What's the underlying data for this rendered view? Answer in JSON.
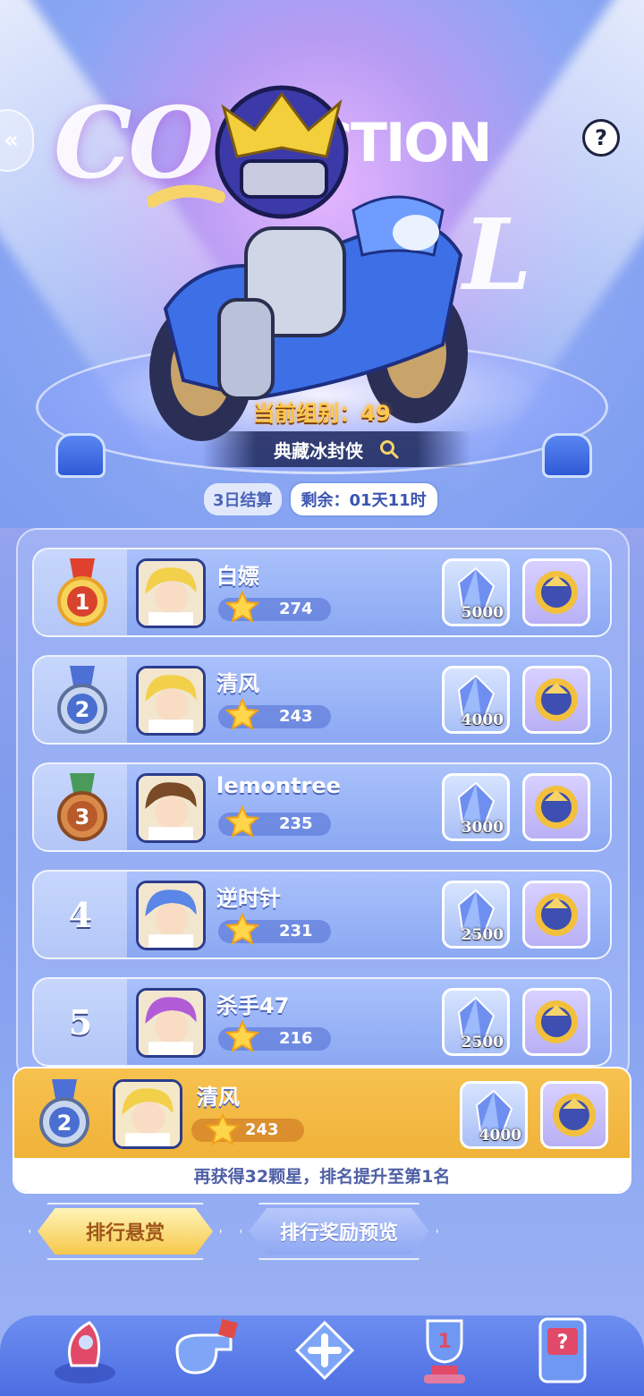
{
  "banner": {
    "title_art_1": "CO",
    "title_art_2": "LL",
    "title_art_small": "CTION",
    "group_label": "当前组别：49",
    "featured_name": "典藏冰封侠",
    "help_label": "?",
    "side_tab_label": "«"
  },
  "timer": {
    "settle_label": "3日结算",
    "remaining_label": "剩余：01天11时"
  },
  "leaderboard": [
    {
      "rank": "1",
      "name": "白嫖",
      "score": "274",
      "reward_qty": "5000",
      "medal": "gold-medal"
    },
    {
      "rank": "2",
      "name": "清风",
      "score": "243",
      "reward_qty": "4000",
      "medal": "silver-medal"
    },
    {
      "rank": "3",
      "name": "lemontree",
      "score": "235",
      "reward_qty": "3000",
      "medal": "bronze-medal"
    },
    {
      "rank": "4",
      "name": "逆时针",
      "score": "231",
      "reward_qty": "2500",
      "medal": ""
    },
    {
      "rank": "5",
      "name": "杀手47",
      "score": "216",
      "reward_qty": "2500",
      "medal": ""
    }
  ],
  "my_entry": {
    "rank": "2",
    "name": "清风",
    "score": "243",
    "reward_qty": "4000",
    "hint": "再获得32颗星，排名提升至第1名"
  },
  "tabs": {
    "active_label": "排行悬赏",
    "inactive_label": "排行奖励预览"
  },
  "nav": [
    "rocket-icon",
    "whistle-icon",
    "gamepad-icon",
    "trophy-icon",
    "vending-machine-icon"
  ],
  "colors": {
    "gold": "#f4c04a",
    "accent_blue": "#7b9ae8",
    "group_label": "#ffc84a"
  }
}
